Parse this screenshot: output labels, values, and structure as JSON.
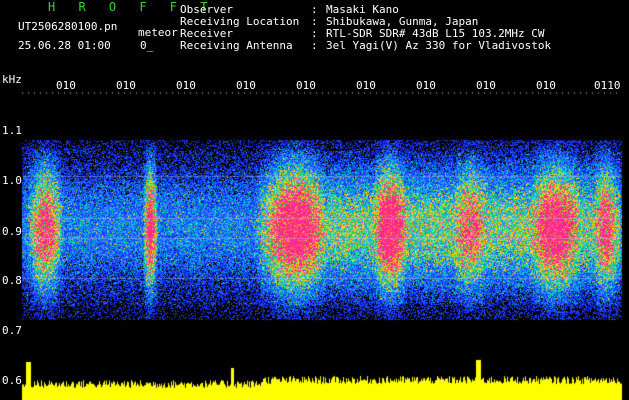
{
  "app": {
    "title": "H R O F F T"
  },
  "file": {
    "name": "UT2506280100.pn",
    "suffix": "meteor"
  },
  "timestamp": {
    "date_time": "25.06.28 01:00",
    "trail": "0_"
  },
  "info": [
    {
      "label": "Observer",
      "value": "Masaki Kano"
    },
    {
      "label": "Receiving Location",
      "value": "Shibukawa, Gunma, Japan"
    },
    {
      "label": "Receiver",
      "value": "RTL-SDR SDR# 43dB L15 103.2MHz CW"
    },
    {
      "label": "Receiving Antenna",
      "value": "3el Yagi(V) Az 330 for Vladivostok"
    }
  ],
  "info_colon": ":",
  "axis": {
    "y_unit": "kHz",
    "y_ticks": [
      "1.1",
      "1.0",
      "0.9",
      "0.8",
      "0.7",
      "0.6"
    ],
    "x_ticks": [
      "010",
      "010",
      "010",
      "010",
      "010",
      "010",
      "010",
      "010",
      "010",
      "0110"
    ]
  },
  "colors": {
    "background": "#000000",
    "title": "#33d633",
    "signal_low": "#1a3cff",
    "signal_mid": "#00c8c8",
    "signal_high": "#ff2a8a",
    "power_trace": "#ffff00"
  }
}
